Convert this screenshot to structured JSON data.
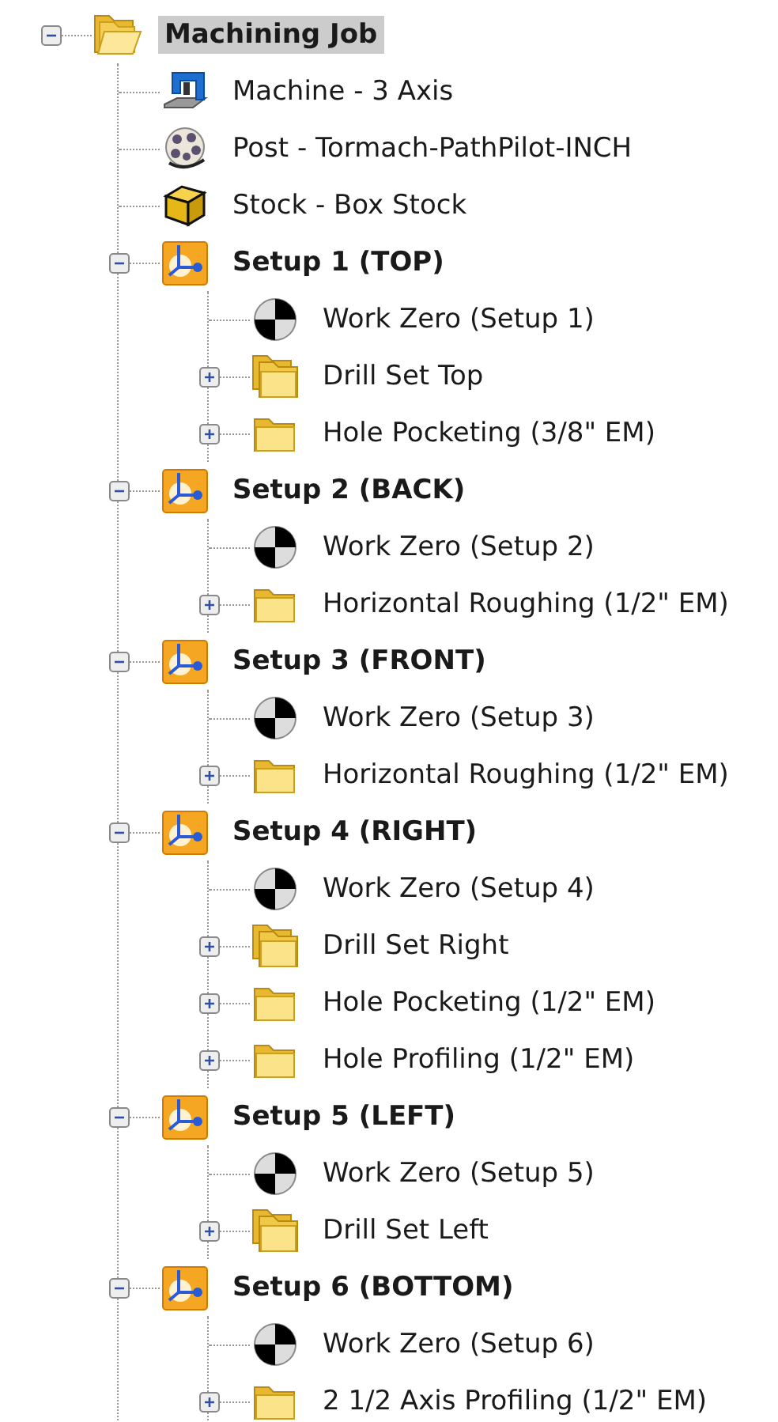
{
  "tree": [
    {
      "kind": "job",
      "label": "Machining Job",
      "selected": true,
      "expanded": true,
      "children": [
        {
          "kind": "machine",
          "label": "Machine - 3 Axis",
          "selected": false
        },
        {
          "kind": "post",
          "label": "Post - Tormach-PathPilot-INCH",
          "selected": false
        },
        {
          "kind": "stock",
          "label": "Stock - Box Stock",
          "selected": false
        },
        {
          "kind": "setup",
          "label": "Setup 1 (TOP)",
          "selected": false,
          "expanded": true,
          "children": [
            {
              "kind": "work-zero",
              "label": "Work Zero (Setup 1)",
              "selected": false
            },
            {
              "kind": "folder-set",
              "label": "Drill Set Top",
              "selected": false,
              "expanded": false
            },
            {
              "kind": "folder",
              "label": "Hole Pocketing (3/8\" EM)",
              "selected": false,
              "expanded": false
            }
          ]
        },
        {
          "kind": "setup",
          "label": "Setup 2 (BACK)",
          "selected": false,
          "expanded": true,
          "children": [
            {
              "kind": "work-zero",
              "label": "Work Zero (Setup 2)",
              "selected": false
            },
            {
              "kind": "folder",
              "label": "Horizontal Roughing (1/2\" EM)",
              "selected": false,
              "expanded": false
            }
          ]
        },
        {
          "kind": "setup",
          "label": "Setup 3 (FRONT)",
          "selected": false,
          "expanded": true,
          "children": [
            {
              "kind": "work-zero",
              "label": "Work Zero (Setup 3)",
              "selected": false
            },
            {
              "kind": "folder",
              "label": "Horizontal Roughing (1/2\" EM)",
              "selected": false,
              "expanded": false
            }
          ]
        },
        {
          "kind": "setup",
          "label": "Setup 4 (RIGHT)",
          "selected": false,
          "expanded": true,
          "children": [
            {
              "kind": "work-zero",
              "label": "Work Zero (Setup 4)",
              "selected": false
            },
            {
              "kind": "folder-set",
              "label": "Drill Set Right",
              "selected": false,
              "expanded": false
            },
            {
              "kind": "folder",
              "label": "Hole Pocketing (1/2\" EM)",
              "selected": false,
              "expanded": false
            },
            {
              "kind": "folder",
              "label": "Hole Profiling (1/2\" EM)",
              "selected": false,
              "expanded": false
            }
          ]
        },
        {
          "kind": "setup",
          "label": "Setup 5 (LEFT)",
          "selected": false,
          "expanded": true,
          "children": [
            {
              "kind": "work-zero",
              "label": "Work Zero (Setup 5)",
              "selected": false
            },
            {
              "kind": "folder-set",
              "label": "Drill Set Left",
              "selected": false,
              "expanded": false
            }
          ]
        },
        {
          "kind": "setup",
          "label": "Setup 6 (BOTTOM)",
          "selected": false,
          "expanded": true,
          "children": [
            {
              "kind": "work-zero",
              "label": "Work Zero (Setup 6)",
              "selected": false
            },
            {
              "kind": "folder",
              "label": "2 1/2 Axis Profiling (1/2\" EM)",
              "selected": false,
              "expanded": false
            }
          ]
        }
      ]
    }
  ]
}
